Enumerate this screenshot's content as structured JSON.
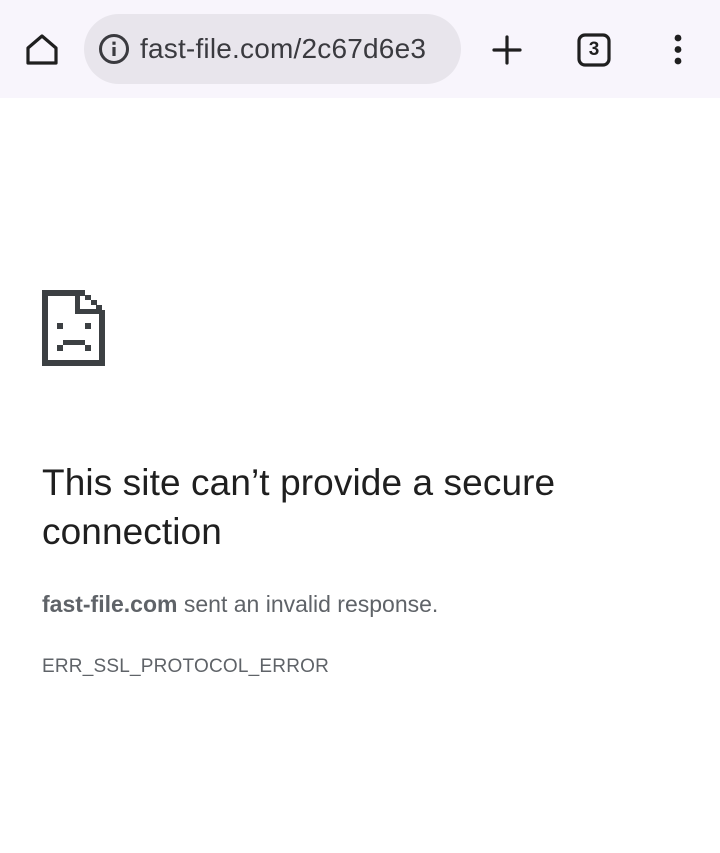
{
  "toolbar": {
    "home_icon": "home-icon",
    "site_info_icon": "info-icon",
    "url": "fast-file.com/2c67d6e3",
    "new_tab_icon": "plus-icon",
    "tab_count": "3",
    "menu_icon": "more-vert-icon"
  },
  "error": {
    "icon": "sad-document-icon",
    "title": "This site can’t provide a secure connection",
    "host": "fast-file.com",
    "message_suffix": " sent an invalid response.",
    "code": "ERR_SSL_PROTOCOL_ERROR"
  },
  "colors": {
    "toolbar_bg": "#f8f5fc",
    "omnibox_bg": "#e8e5ec",
    "title_text": "#1f1f1f",
    "secondary_text": "#5f6368"
  }
}
